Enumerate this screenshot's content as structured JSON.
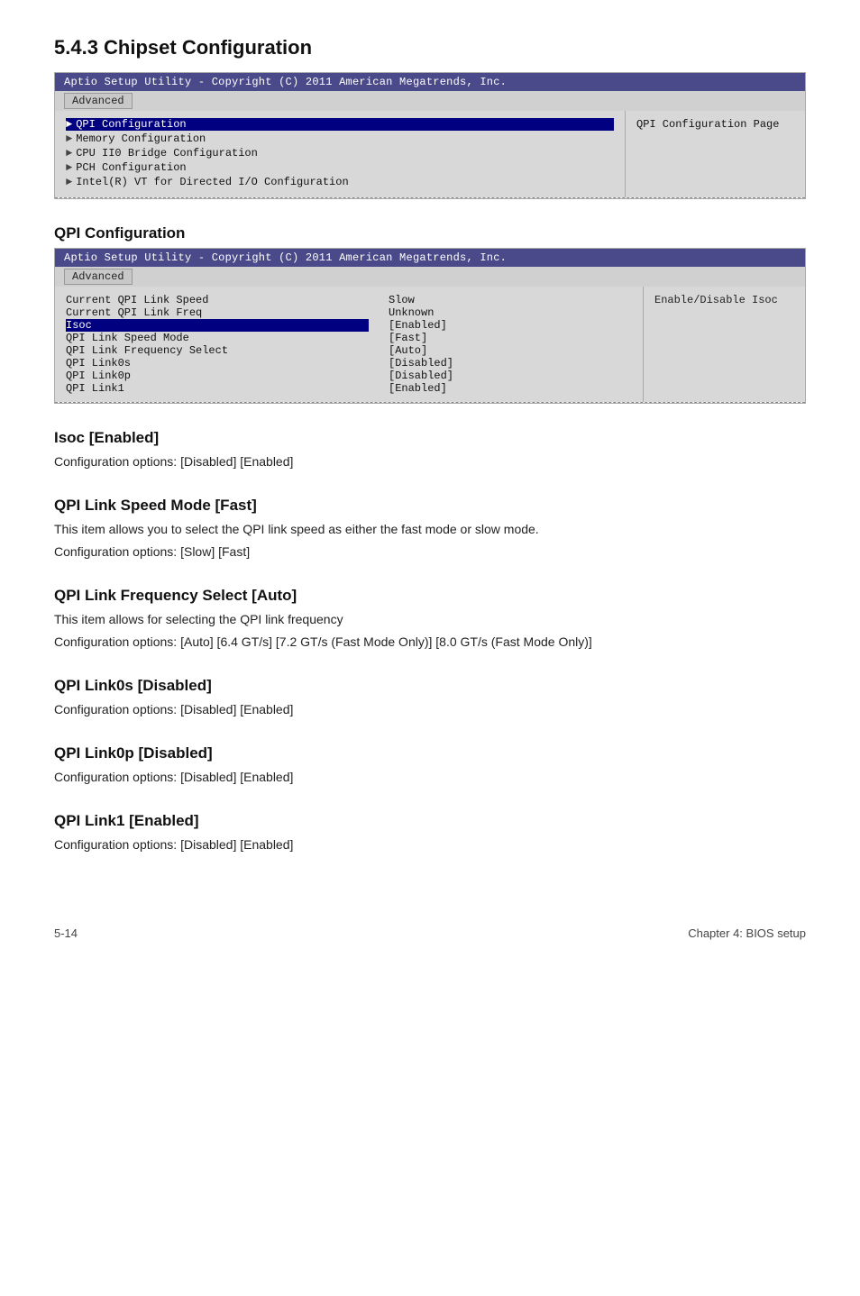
{
  "page": {
    "title": "5.4.3   Chipset Configuration",
    "footer_page": "5-14",
    "footer_chapter": "Chapter 4: BIOS setup"
  },
  "chipset_bios": {
    "header": "Aptio Setup Utility - Copyright (C) 2011 American Megatrends, Inc.",
    "tab": "Advanced",
    "menu_items": [
      {
        "label": "QPI Configuration",
        "selected": true
      },
      {
        "label": "Memory Configuration",
        "selected": false
      },
      {
        "label": "CPU II0 Bridge Configuration",
        "selected": false
      },
      {
        "label": "PCH Configuration",
        "selected": false
      },
      {
        "label": "Intel(R) VT for Directed I/O Configuration",
        "selected": false
      }
    ],
    "right_text": "QPI Configuration Page"
  },
  "qpi_section": {
    "title": "QPI Configuration",
    "bios": {
      "header": "Aptio Setup Utility - Copyright (C) 2011 American Megatrends, Inc.",
      "tab": "Advanced",
      "rows": [
        {
          "label": "Current QPI Link Speed",
          "value": "Slow",
          "selected": false
        },
        {
          "label": "Current QPI Link Freq",
          "value": "Unknown",
          "selected": false
        },
        {
          "label": "Isoc",
          "value": "[Enabled]",
          "selected": true
        },
        {
          "label": "QPI Link Speed Mode",
          "value": "[Fast]",
          "selected": false
        },
        {
          "label": "QPI Link Frequency Select",
          "value": "[Auto]",
          "selected": false
        },
        {
          "label": "QPI Link0s",
          "value": "[Disabled]",
          "selected": false
        },
        {
          "label": "QPI Link0p",
          "value": "[Disabled]",
          "selected": false
        },
        {
          "label": "QPI Link1",
          "value": "[Enabled]",
          "selected": false
        }
      ],
      "right_text": "Enable/Disable Isoc"
    }
  },
  "isoc": {
    "title": "Isoc [Enabled]",
    "description": "Configuration options: [Disabled] [Enabled]"
  },
  "qpi_link_speed_mode": {
    "title": "QPI Link Speed Mode [Fast]",
    "description1": "This item allows you to select the QPI link speed as either the fast mode or slow mode.",
    "description2": "Configuration options: [Slow] [Fast]"
  },
  "qpi_link_freq": {
    "title": "QPI Link Frequency Select [Auto]",
    "description1": "This item allows for selecting the QPI link frequency",
    "description2": "Configuration options: [Auto] [6.4 GT/s] [7.2 GT/s (Fast Mode Only)] [8.0 GT/s (Fast Mode Only)]"
  },
  "qpi_link0s": {
    "title": "QPI Link0s [Disabled]",
    "description": "Configuration options: [Disabled] [Enabled]"
  },
  "qpi_link0p": {
    "title": "QPI Link0p [Disabled]",
    "description": "Configuration options: [Disabled] [Enabled]"
  },
  "qpi_link1": {
    "title": "QPI Link1 [Enabled]",
    "description": "Configuration options: [Disabled] [Enabled]"
  }
}
